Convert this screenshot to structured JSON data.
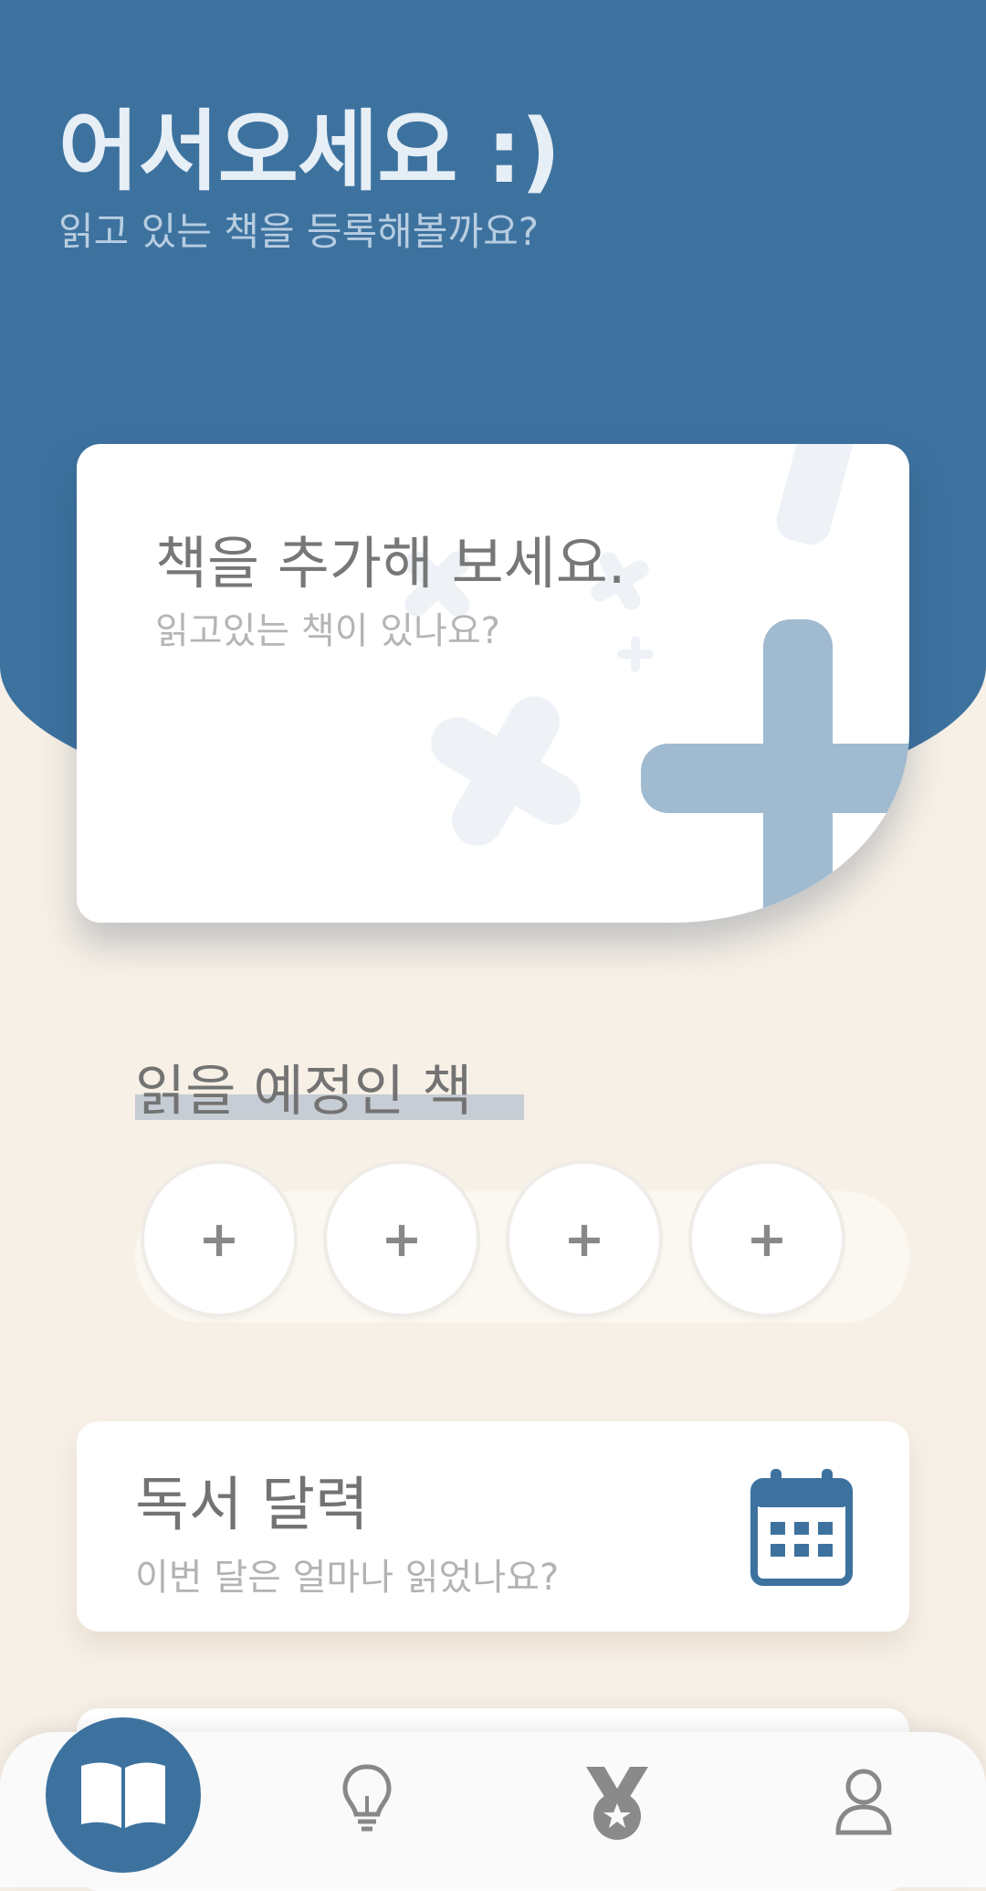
{
  "header": {
    "title": "어서오세요 :)",
    "subtitle": "읽고 있는 책을 등록해볼까요?"
  },
  "add_card": {
    "title": "책을 추가해 보세요.",
    "subtitle": "읽고있는 책이 있나요?"
  },
  "planned_books": {
    "title": "읽을 예정인 책",
    "slots": [
      "+",
      "+",
      "+",
      "+"
    ]
  },
  "calendar_card": {
    "title": "독서 달력",
    "subtitle": "이번 달은 얼마나 읽었나요?"
  },
  "bottom_nav": {
    "items": [
      "book-icon",
      "lightbulb-icon",
      "medal-icon",
      "user-icon"
    ],
    "active": "book-icon"
  },
  "colors": {
    "primary": "#3d729f",
    "background": "#f7f0e6",
    "accent_light": "#a0bad0"
  }
}
